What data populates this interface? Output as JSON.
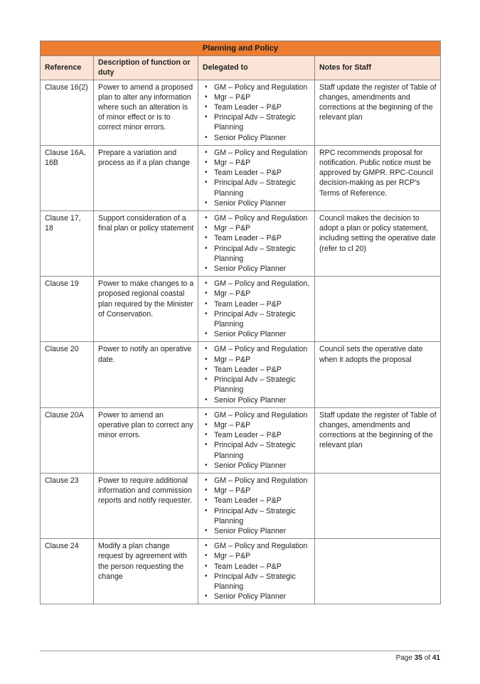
{
  "table": {
    "title": "Planning and Policy",
    "headers": [
      "Reference",
      "Description of function or duty",
      "Delegated to",
      "Notes for Staff"
    ],
    "rows": [
      {
        "reference": "Clause 16(2)",
        "description": "Power to amend a proposed plan to alter any information where such an alteration is of minor effect or is to correct minor errors.",
        "delegated_to": [
          "GM – Policy and Regulation",
          "Mgr – P&P",
          "Team Leader – P&P",
          "Principal Adv – Strategic Planning",
          "Senior Policy Planner"
        ],
        "notes": "Staff update the register of Table of changes, amendments and corrections at the beginning of the relevant plan"
      },
      {
        "reference": "Clause 16A, 16B",
        "description": "Prepare a variation and process as if a plan change",
        "delegated_to": [
          "GM – Policy and Regulation",
          "Mgr – P&P",
          "Team Leader – P&P",
          "Principal Adv – Strategic Planning",
          "Senior Policy Planner"
        ],
        "notes": "RPC recommends proposal for notification. Public notice must be approved by GMPR. RPC-Council decision-making as per RCP's Terms of Reference."
      },
      {
        "reference": "Clause 17, 18",
        "description": "Support consideration of a final plan or policy statement",
        "delegated_to": [
          "GM – Policy and Regulation",
          "Mgr – P&P",
          "Team Leader – P&P",
          "Principal Adv – Strategic Planning",
          "Senior Policy Planner"
        ],
        "notes": "Council  makes the decision to adopt a plan or policy statement, including setting the operative date (refer to cl 20)"
      },
      {
        "reference": "Clause 19",
        "description": "Power to make changes to a proposed regional coastal plan required by the Minister of Conservation.",
        "delegated_to": [
          "GM – Policy and Regulation,",
          "Mgr – P&P",
          "Team Leader – P&P",
          "Principal Adv – Strategic Planning",
          "Senior Policy Planner"
        ],
        "notes": ""
      },
      {
        "reference": "Clause 20",
        "description": "Power to notify an operative date.",
        "delegated_to": [
          "GM – Policy and Regulation",
          "Mgr – P&P",
          "Team Leader – P&P",
          "Principal Adv – Strategic Planning",
          "Senior Policy Planner"
        ],
        "notes": "Council sets the operative date when it adopts the proposal"
      },
      {
        "reference": "Clause 20A",
        "description": "Power to amend an operative plan to correct any minor errors.",
        "delegated_to": [
          "GM – Policy and Regulation",
          "Mgr – P&P",
          "Team Leader – P&P",
          "Principal Adv – Strategic Planning",
          "Senior Policy Planner"
        ],
        "notes": "Staff update the register of Table of changes, amendments and corrections at the beginning of the relevant plan"
      },
      {
        "reference": "Clause 23",
        "description": "Power to require additional information and commission reports and notify requester.",
        "delegated_to": [
          "GM – Policy and Regulation",
          "Mgr – P&P",
          "Team Leader – P&P",
          "Principal Adv – Strategic Planning",
          "Senior Policy Planner"
        ],
        "notes": ""
      },
      {
        "reference": "Clause 24",
        "description": "Modify a plan change request by agreement with the person requesting the change",
        "delegated_to": [
          "GM – Policy and Regulation",
          "Mgr – P&P",
          "Team Leader – P&P",
          "Principal Adv – Strategic Planning",
          "Senior Policy Planner"
        ],
        "notes": ""
      }
    ]
  },
  "footer": {
    "page_label": "Page",
    "page_current": "35",
    "of_label": "of",
    "page_total": "41"
  },
  "colors": {
    "title_bg": "#ed7d31",
    "header_bg": "#fbe4d5",
    "border": "#8a8a8a"
  },
  "icons": {
    "bullet": "•"
  }
}
